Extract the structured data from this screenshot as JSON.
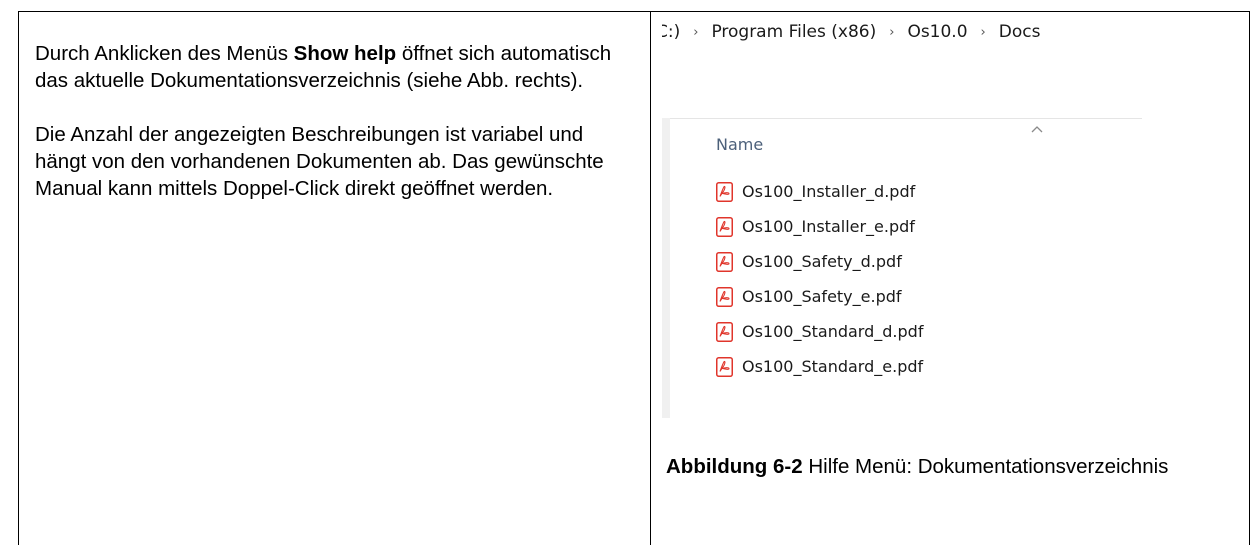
{
  "left": {
    "p1_pre": "Durch Anklicken des Menüs ",
    "p1_bold": "Show help",
    "p1_post": " öffnet sich automatisch das aktuelle Dokumentationsverzeichnis (siehe Abb. rechts).",
    "p2": "Die Anzahl der angezeigten Beschreibungen ist variabel und hängt von den vorhandenen Dokumenten ab. Das gewünschte Manual kann mittels Doppel-Click direkt geöffnet werden."
  },
  "explorer": {
    "breadcrumb": ":)",
    "path": [
      "C:)",
      "Program Files (x86)",
      "Os10.0",
      "Docs"
    ],
    "column_header": "Name",
    "files": [
      "Os100_Installer_d.pdf",
      "Os100_Installer_e.pdf",
      "Os100_Safety_d.pdf",
      "Os100_Safety_e.pdf",
      "Os100_Standard_d.pdf",
      "Os100_Standard_e.pdf"
    ],
    "icons": {
      "file": "pdf-file-icon",
      "separator": "chevron-right-icon",
      "sort": "sort-up-icon"
    },
    "pdf_color": "#e0352b"
  },
  "caption": {
    "label": "Abbildung 6-2",
    "text": " Hilfe Menü: Dokumentationsverzeichnis"
  }
}
